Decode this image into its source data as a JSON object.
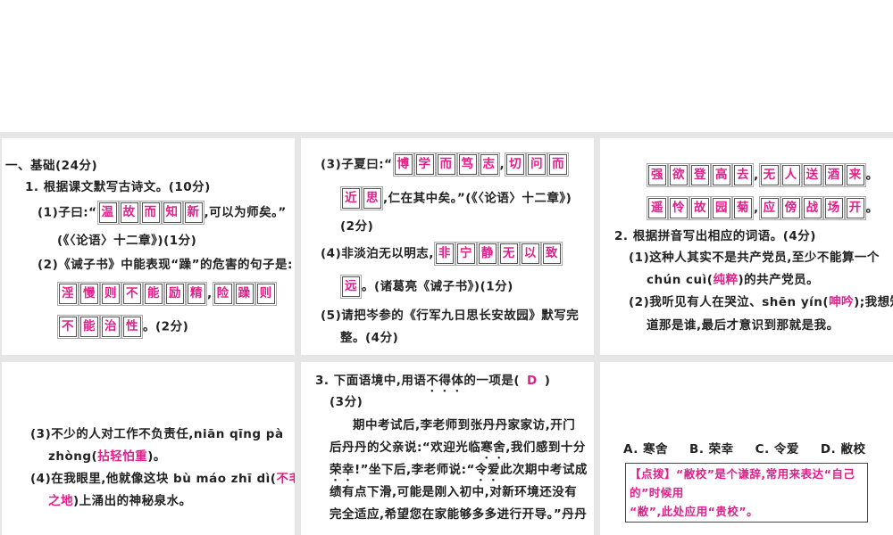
{
  "section_title": "一、基础(24分)",
  "q1": {
    "title": "1. 根据课文默写古诗文。(10分)",
    "p1_pre": "(1)子曰:“",
    "p1_boxes": [
      "温",
      "故",
      "而",
      "知",
      "新"
    ],
    "p1_post": ",可以为师矣。”",
    "p1_src": "(《〈论语〉十二章》)(1分)",
    "p2_title": "(2)《诫子书》中能表现“躁”的危害的句子是:",
    "p2_boxes_a": [
      "淫",
      "慢",
      "则",
      "不",
      "能",
      "励",
      "精"
    ],
    "p2_comma": ",",
    "p2_boxes_b": [
      "险",
      "躁",
      "则"
    ],
    "p2_boxes_c": [
      "不",
      "能",
      "治",
      "性"
    ],
    "p2_post": "。(2分)",
    "p3_pre": "(3)子夏曰:“",
    "p3_boxes_a": [
      "博",
      "学",
      "而",
      "笃",
      "志"
    ],
    "p3_comma": ",",
    "p3_boxes_b": [
      "切",
      "问",
      "而"
    ],
    "p3_boxes_c": [
      "近",
      "思"
    ],
    "p3_post": ",仁在其中矣。”(《〈论语〉十二章》)",
    "p3_score": "(2分)",
    "p4_pre": "(4)非淡泊无以明志,",
    "p4_boxes": [
      "非",
      "宁",
      "静",
      "无",
      "以",
      "致"
    ],
    "p4_boxes_b": [
      "远"
    ],
    "p4_post": "。(诸葛亮《诫子书》)(1分)",
    "p5_line1": "(5)请把岑参的《行军九日思长安故园》默写完",
    "p5_line2": "整。(4分)",
    "poem_a": [
      "强",
      "欲",
      "登",
      "高",
      "去"
    ],
    "poem_b": [
      "无",
      "人",
      "送",
      "酒",
      "来"
    ],
    "poem_c": [
      "遥",
      "怜",
      "故",
      "园",
      "菊"
    ],
    "poem_d": [
      "应",
      "傍",
      "战",
      "场",
      "开"
    ],
    "comma": ",",
    "period": "。"
  },
  "q2": {
    "title": "2. 根据拼音写出相应的词语。(4分)",
    "i1_l1": "(1)这种人其实不是共产党员,至少不能算一个",
    "i1_py": "chún cuì(",
    "i1_ans": "纯粹",
    "i1_post": ")的共产党员。",
    "i2_pre": "(2)我听见有人在哭泣、shēn yín(",
    "i2_ans": "呻吟",
    "i2_post": ");我想知",
    "i2_l2": "道那是谁,最后才意识到那就是我。",
    "i3_l1": "(3)不少的人对工作不负责任,niān qīng pà",
    "i3_py": "zhòng(",
    "i3_ans": "拈轻怕重",
    "i3_post": ")。",
    "i4_pre": "(4)在我眼里,他就像这块 bù máo zhī dì(",
    "i4_ans_a": "不毛",
    "i4_ans_b": "之地",
    "i4_post": ")上涌出的神秘泉水。"
  },
  "q3": {
    "title_a": "3. 下面语境中,用语",
    "title_dot": "不得体",
    "title_b": "的一项是(",
    "answer": "D",
    "title_c": ")",
    "score": "(3分)",
    "p_l1": "期中考试后,李老师到张丹丹家家访,开门",
    "p_l2a": "后丹丹的父亲说:“欢迎光临",
    "p_l2d": "寒舍",
    "p_l2b": ",我们感到十分",
    "p_l3d": "荣幸",
    "p_l3a": "!”坐下后,李老师说:“",
    "p_l3d2": "令爱",
    "p_l3b": "此次期中考试成",
    "p_l4": "绩有点下滑,可能是刚入初中,对新环境还没有",
    "p_l5": "完全适应,希望您在家能够多多进行开导。”丹丹",
    "options": [
      "A. 寒舍",
      "B. 荣幸",
      "C. 令爱",
      "D. 敝校"
    ],
    "tip_l1": "【点拨】“敝校”是个谦辞,常用来表达“自己的”时候用",
    "tip_l2": "“敝”,此处应用“贵校”。"
  }
}
